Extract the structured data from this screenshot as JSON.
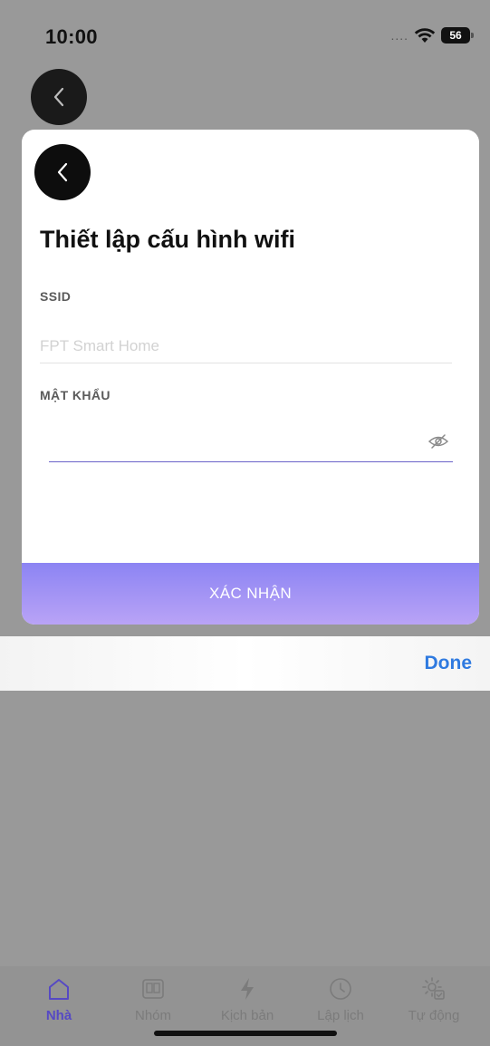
{
  "status_bar": {
    "time": "10:00",
    "signal": "....",
    "battery": "56"
  },
  "modal": {
    "title": "Thiết lập cấu hình wifi",
    "ssid_label": "SSID",
    "ssid_placeholder": "FPT Smart Home",
    "password_label": "MẬT KHẨU",
    "password_value": "",
    "confirm_label": "XÁC NHẬN"
  },
  "accessory": {
    "done_label": "Done"
  },
  "tabs": [
    {
      "label": "Nhà",
      "icon": "home-icon",
      "active": true
    },
    {
      "label": "Nhóm",
      "icon": "group-icon",
      "active": false
    },
    {
      "label": "Kịch bản",
      "icon": "lightning-icon",
      "active": false
    },
    {
      "label": "Lập lịch",
      "icon": "clock-icon",
      "active": false
    },
    {
      "label": "Tự động",
      "icon": "automation-gear-icon",
      "active": false
    }
  ],
  "colors": {
    "accent": "#5649c4",
    "button_gradient_start": "#8c84f3",
    "button_gradient_end": "#b9a3f6",
    "done": "#2f7ae0"
  }
}
